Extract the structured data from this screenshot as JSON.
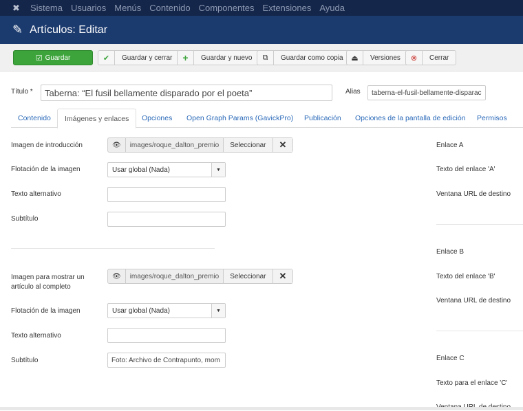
{
  "nav": {
    "items": [
      "Sistema",
      "Usuarios",
      "Menús",
      "Contenido",
      "Componentes",
      "Extensiones",
      "Ayuda"
    ]
  },
  "header": {
    "title": "Artículos: Editar"
  },
  "toolbar": {
    "save": "Guardar",
    "save_close": "Guardar y cerrar",
    "save_new": "Guardar y nuevo",
    "save_copy": "Guardar como copia",
    "versions": "Versiones",
    "close": "Cerrar"
  },
  "title_field": {
    "label": "Título *",
    "value": "Taberna: “El fusil bellamente disparado por el poeta”"
  },
  "alias_field": {
    "label": "Alias",
    "value": "taberna-el-fusil-bellamente-disparac"
  },
  "tabs": [
    "Contenido",
    "Imágenes y enlaces",
    "Opciones",
    "Open Graph Params (GavickPro)",
    "Publicación",
    "Opciones de la pantalla de edición",
    "Permisos"
  ],
  "intro": {
    "image_label": "Imagen de introducción",
    "image_value": "images/roque_dalton_premio",
    "select": "Seleccionar",
    "float_label": "Flotación de la imagen",
    "float_value": "Usar global (Nada)",
    "alt_label": "Texto alternativo",
    "alt_value": "",
    "caption_label": "Subtítulo",
    "caption_value": ""
  },
  "full": {
    "image_label": "Imagen para mostrar un artículo al completo",
    "image_value": "images/roque_dalton_premio",
    "select": "Seleccionar",
    "float_label": "Flotación de la imagen",
    "float_value": "Usar global (Nada)",
    "alt_label": "Texto alternativo",
    "alt_value": "",
    "caption_label": "Subtítulo",
    "caption_value": "Foto: Archivo de Contrapunto, mom"
  },
  "links": {
    "a": "Enlace A",
    "a_text": "Texto del enlace 'A'",
    "a_window": "Ventana URL de destino",
    "b": "Enlace B",
    "b_text": "Texto del enlace 'B'",
    "b_window": "Ventana URL de destino",
    "c": "Enlace C",
    "c_text": "Texto para el enlace 'C'",
    "c_window": "Ventana URL de destino"
  }
}
